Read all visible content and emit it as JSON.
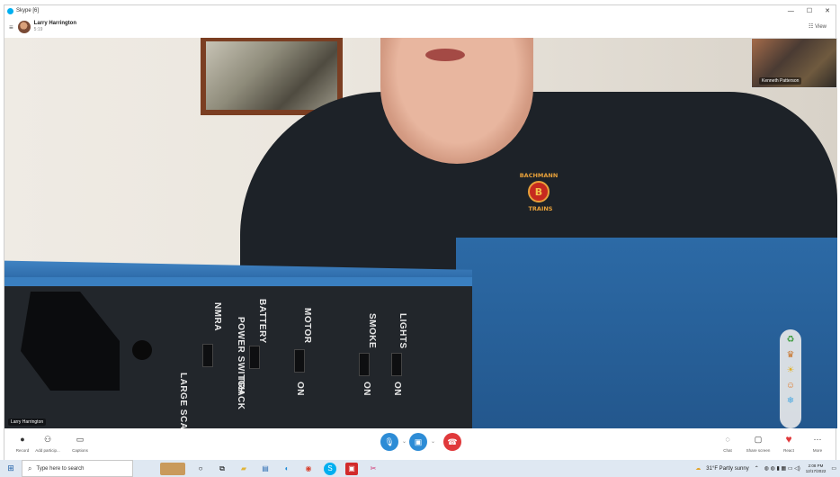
{
  "window": {
    "title": "Skype [6]",
    "controls": [
      "—",
      "☐",
      "✕"
    ]
  },
  "call": {
    "caller_name": "Larry Harrington",
    "elapsed": "5:19",
    "view_label": "View",
    "self_label": "Larry Harrington",
    "pip_label": "Kenneth Patterson"
  },
  "panel_labels": {
    "nmra": "NMRA",
    "large_scale": "LARGE SCALE",
    "battery": "BATTERY",
    "power_switch": "POWER SWITCH",
    "track": "TRACK",
    "motor": "MOTOR",
    "on1": "ON",
    "smoke": "SMOKE",
    "on2": "ON",
    "lights": "LIGHTS",
    "on3": "ON"
  },
  "logo": {
    "top": "BACHMANN",
    "bottom": "TRAINS"
  },
  "controls": {
    "record": "Record",
    "add_participant": "Add particip...",
    "captions": "Captions",
    "chat": "Chat",
    "share_screen": "Share screen",
    "react": "React",
    "more": "More"
  },
  "taskbar": {
    "search_placeholder": "Type here to search",
    "weather": "31°F  Partly sunny",
    "time": "2:08 PM",
    "date": "12/17/2022"
  },
  "colors": {
    "mic": "#2d8cd6",
    "video": "#2d8cd6",
    "hangup": "#e0393b",
    "skype": "#00aff0"
  }
}
